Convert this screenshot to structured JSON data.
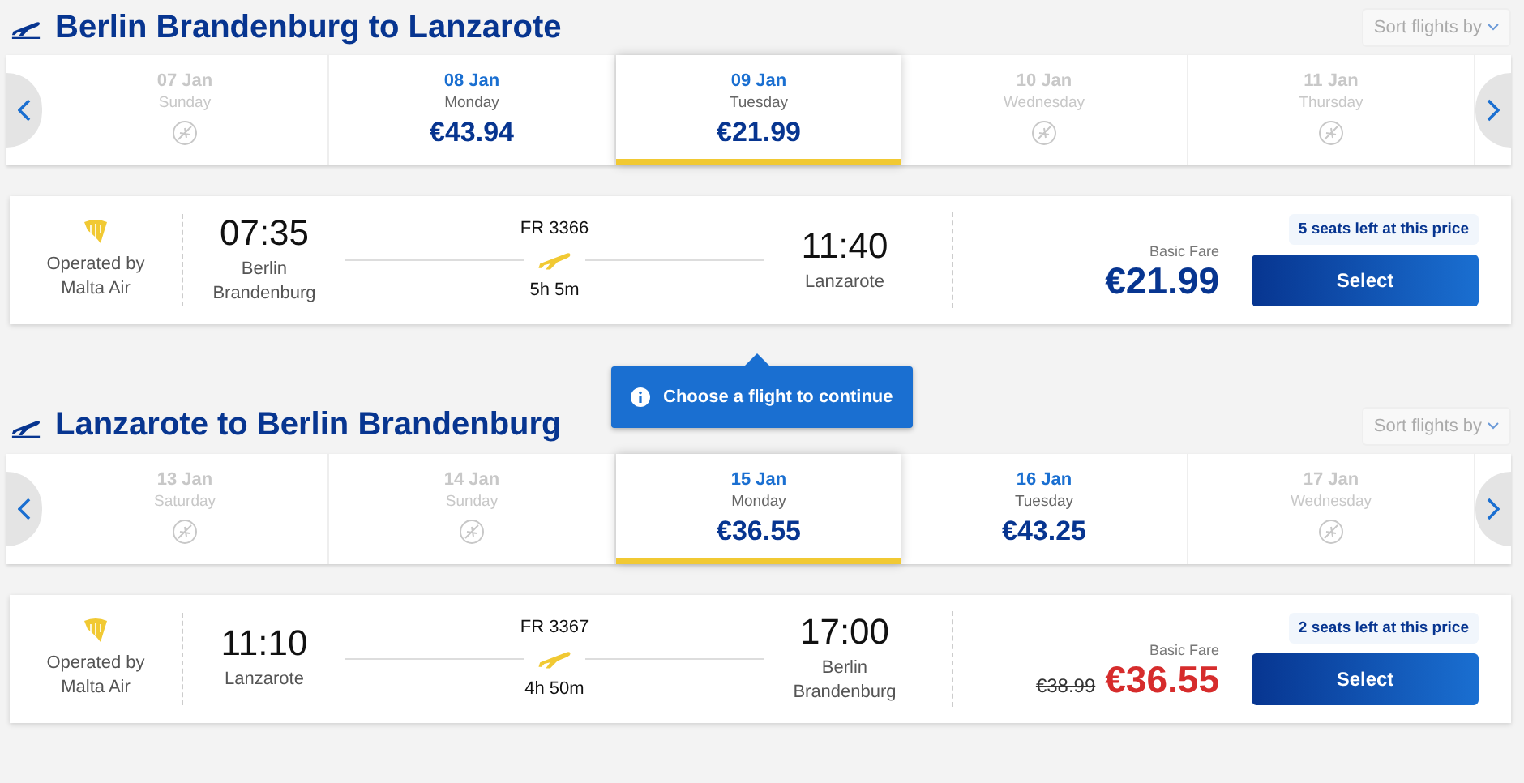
{
  "sections": [
    {
      "title": "Berlin Brandenburg to Lanzarote",
      "sort_label": "Sort flights by",
      "dates": [
        {
          "date": "07 Jan",
          "day": "Sunday",
          "available": false,
          "selected": false
        },
        {
          "date": "08 Jan",
          "day": "Monday",
          "price": "€43.94",
          "available": true,
          "selected": false
        },
        {
          "date": "09 Jan",
          "day": "Tuesday",
          "price": "€21.99",
          "available": true,
          "selected": true
        },
        {
          "date": "10 Jan",
          "day": "Wednesday",
          "available": false,
          "selected": false
        },
        {
          "date": "11 Jan",
          "day": "Thursday",
          "available": false,
          "selected": false
        }
      ],
      "flight": {
        "operator": "Operated by\nMalta Air",
        "depart_time": "07:35",
        "depart_place": "Berlin\nBrandenburg",
        "flight_number": "FR 3366",
        "duration": "5h 5m",
        "arrive_time": "11:40",
        "arrive_place": "Lanzarote",
        "seats_badge": "5 seats left at this price",
        "fare_label": "Basic Fare",
        "price": "€21.99",
        "discounted": false,
        "button": "Select"
      }
    },
    {
      "title": "Lanzarote to Berlin Brandenburg",
      "sort_label": "Sort flights by",
      "dates": [
        {
          "date": "13 Jan",
          "day": "Saturday",
          "available": false,
          "selected": false
        },
        {
          "date": "14 Jan",
          "day": "Sunday",
          "available": false,
          "selected": false
        },
        {
          "date": "15 Jan",
          "day": "Monday",
          "price": "€36.55",
          "available": true,
          "selected": true
        },
        {
          "date": "16 Jan",
          "day": "Tuesday",
          "price": "€43.25",
          "available": true,
          "selected": false
        },
        {
          "date": "17 Jan",
          "day": "Wednesday",
          "available": false,
          "selected": false
        }
      ],
      "flight": {
        "operator": "Operated by\nMalta Air",
        "depart_time": "11:10",
        "depart_place": "Lanzarote",
        "flight_number": "FR 3367",
        "duration": "4h 50m",
        "arrive_time": "17:00",
        "arrive_place": "Berlin\nBrandenburg",
        "seats_badge": "2 seats left at this price",
        "fare_label": "Basic Fare",
        "old_price": "€38.99",
        "price": "€36.55",
        "discounted": true,
        "button": "Select"
      }
    }
  ],
  "tooltip": {
    "text": "Choose a flight to continue"
  }
}
